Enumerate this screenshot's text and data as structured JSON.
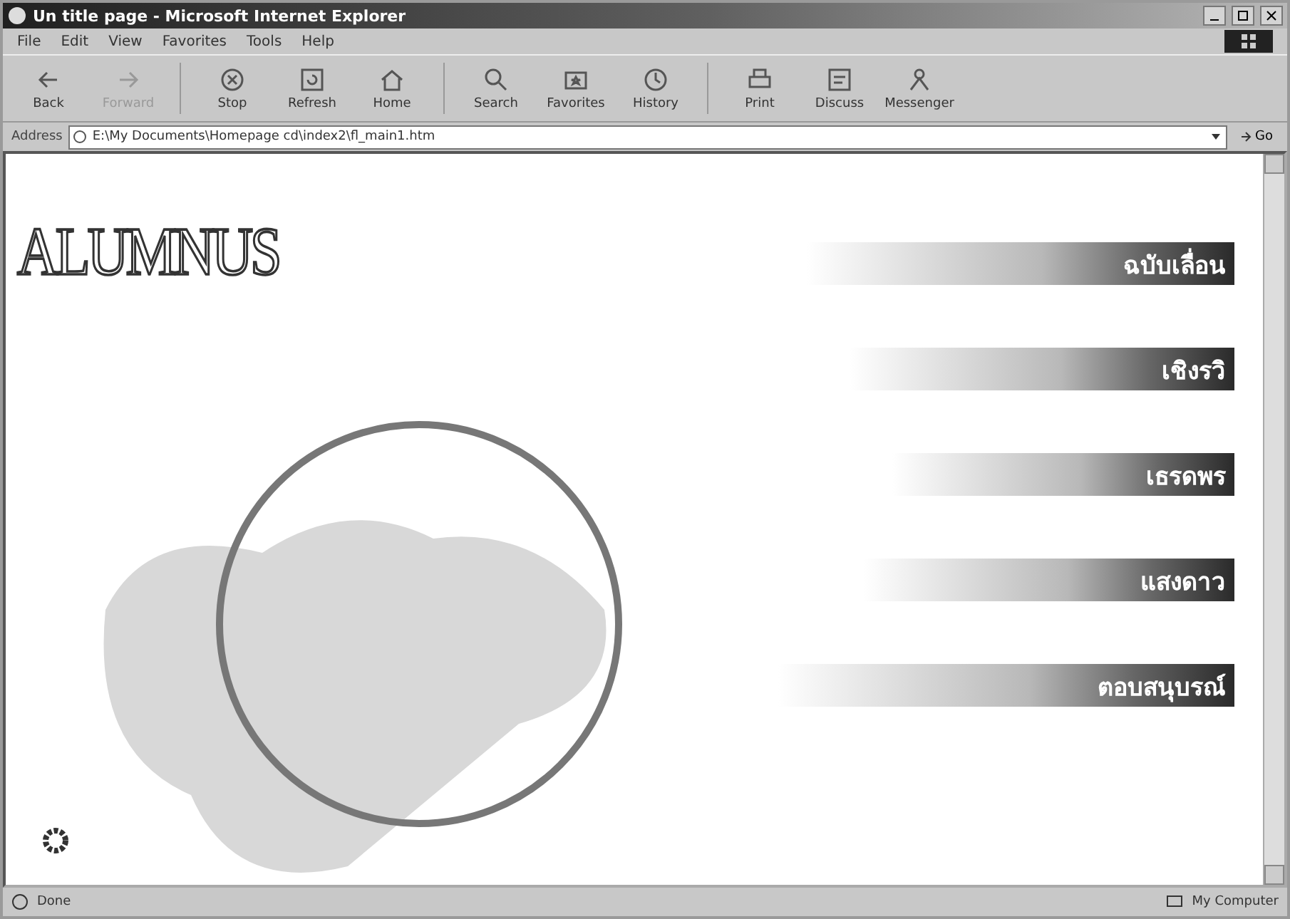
{
  "window": {
    "title": "Un title page - Microsoft Internet Explorer"
  },
  "menu": [
    "File",
    "Edit",
    "View",
    "Favorites",
    "Tools",
    "Help"
  ],
  "toolbar": [
    {
      "label": "Back",
      "kind": "back",
      "disabled": false
    },
    {
      "label": "Forward",
      "kind": "forward",
      "disabled": true
    },
    {
      "label": "Stop",
      "kind": "stop",
      "disabled": false
    },
    {
      "label": "Refresh",
      "kind": "refresh",
      "disabled": false
    },
    {
      "label": "Home",
      "kind": "home",
      "disabled": false
    },
    {
      "label": "Search",
      "kind": "search",
      "disabled": false
    },
    {
      "label": "Favorites",
      "kind": "favorites",
      "disabled": false
    },
    {
      "label": "History",
      "kind": "history",
      "disabled": false
    },
    {
      "label": "Print",
      "kind": "print",
      "disabled": false
    },
    {
      "label": "Discuss",
      "kind": "discuss",
      "disabled": false
    },
    {
      "label": "Messenger",
      "kind": "messenger",
      "disabled": false
    }
  ],
  "address": {
    "label": "Address",
    "value": "E:\\My Documents\\Homepage cd\\index2\\fl_main1.htm",
    "go": "Go"
  },
  "page": {
    "logo": "ALUMNUS",
    "links": [
      "ฉบับเลื่อน",
      "เชิงรวิ",
      "เธรดพร",
      "แสงดาว",
      "ตอบสนุบรณ์"
    ]
  },
  "status_bar": {
    "text": "Done",
    "zone": "My Computer"
  }
}
